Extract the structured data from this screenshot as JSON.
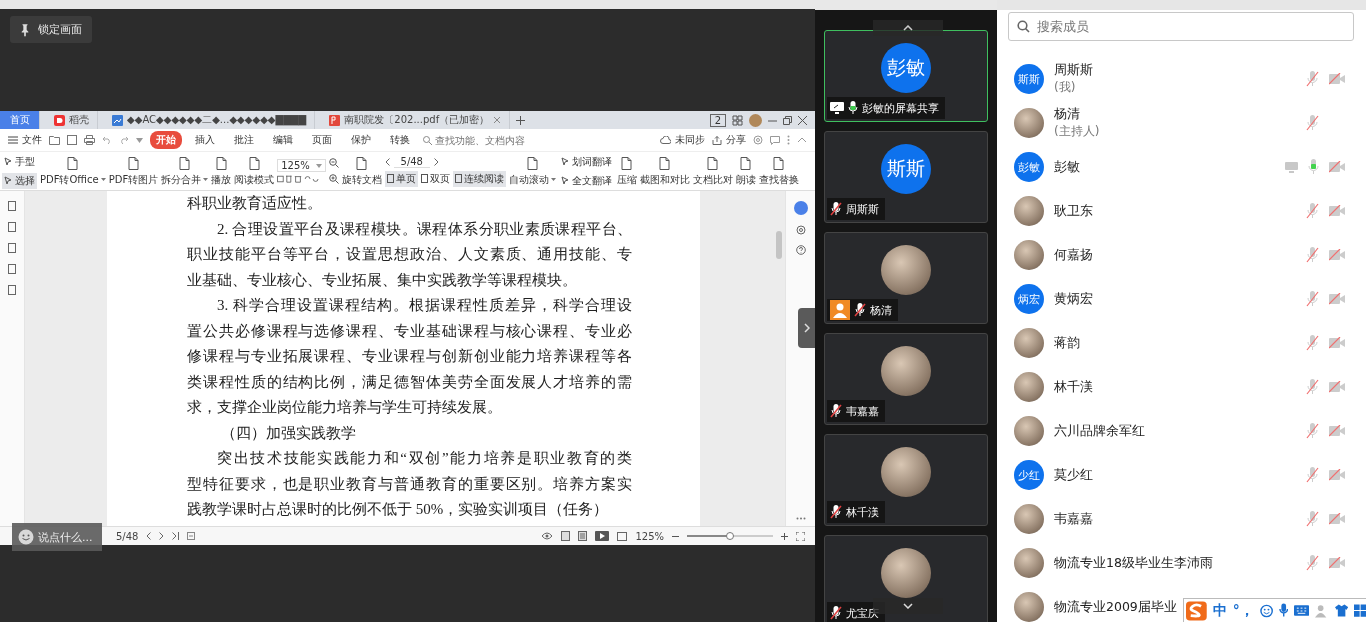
{
  "stage": {
    "lock_button": "锁定画面"
  },
  "wps": {
    "tabs": [
      {
        "label": "首页",
        "selected": true,
        "kind": "home"
      },
      {
        "label": "稻壳",
        "selected": false,
        "kind": "app"
      },
      {
        "label": "◆◆AC◆◆◆◆◆◆二◆...◆◆◆◆◆◆▇▇▇▇",
        "selected": false,
        "kind": "image"
      },
      {
        "label": "南职院发〔202...pdf（已加密）",
        "selected": false,
        "kind": "pdf"
      }
    ],
    "window_badge": "2",
    "menu": {
      "file": "文件",
      "tabs": [
        {
          "label": "开始",
          "selected": true
        },
        {
          "label": "插入",
          "selected": false
        },
        {
          "label": "批注",
          "selected": false
        },
        {
          "label": "编辑",
          "selected": false
        },
        {
          "label": "页面",
          "selected": false
        },
        {
          "label": "保护",
          "selected": false
        },
        {
          "label": "转换",
          "selected": false
        }
      ],
      "search_placeholder": "查找功能、文档内容",
      "sync": "未同步",
      "share": "分享"
    },
    "toolbar": [
      {
        "kind": "stack",
        "items": [
          {
            "label": "手型",
            "selected": false
          },
          {
            "label": "选择",
            "selected": true
          }
        ]
      },
      {
        "kind": "large",
        "label": "PDF转Office",
        "dropdown": true
      },
      {
        "kind": "large",
        "label": "PDF转图片",
        "dropdown": false
      },
      {
        "kind": "large",
        "label": "拆分合并",
        "dropdown": true
      },
      {
        "kind": "large",
        "label": "播放",
        "dropdown": false
      },
      {
        "kind": "large",
        "label": "阅读模式",
        "dropdown": false
      },
      {
        "kind": "zoom",
        "value": "125%"
      },
      {
        "kind": "large",
        "label": "旋转文档",
        "dropdown": false
      },
      {
        "kind": "pager",
        "value": "5/48",
        "items": [
          {
            "label": "单页",
            "selected": true
          },
          {
            "label": "双页",
            "selected": false
          },
          {
            "label": "连续阅读",
            "selected": true
          }
        ]
      },
      {
        "kind": "large",
        "label": "自动滚动",
        "dropdown": true
      },
      {
        "kind": "stack",
        "items": [
          {
            "label": "划词翻译",
            "selected": false
          },
          {
            "label": "全文翻译",
            "selected": false
          }
        ]
      },
      {
        "kind": "large",
        "label": "压缩",
        "dropdown": false
      },
      {
        "kind": "large",
        "label": "截图和对比",
        "dropdown": false
      },
      {
        "kind": "large",
        "label": "文档比对",
        "dropdown": false
      },
      {
        "kind": "large",
        "label": "朗读",
        "dropdown": false
      },
      {
        "kind": "large",
        "label": "查找替换",
        "dropdown": false
      }
    ],
    "document": [
      {
        "kind": "continuation",
        "lines": [
          "科职业教育适应性。"
        ]
      },
      {
        "kind": "paragraph",
        "lines": [
          "2. 合理设置平台及课程模块。课程体系分职业素质课程平台、",
          "职业技能平台等平台，设置思想政治、人文素质、通用技能、专",
          "业基础、专业核心、专业拓展、集中实践教学等课程模块。"
        ]
      },
      {
        "kind": "paragraph",
        "lines": [
          "3. 科学合理设置课程结构。根据课程性质差异，科学合理设",
          "置公共必修课程与选修课程、专业基础课程与核心课程、专业必",
          "修课程与专业拓展课程、专业课程与创新创业能力培养课程等各",
          "类课程性质的结构比例，满足德智体美劳全面发展人才培养的需",
          "求，支撑企业岗位能力培养与学生可持续发展。"
        ]
      },
      {
        "kind": "heading",
        "lines": [
          "（四）加强实践教学"
        ]
      },
      {
        "kind": "paragraph",
        "lines": [
          "突出技术技能实践能力和“双创”能力培养是职业教育的类",
          "型特征要求，也是职业教育与普通教育的重要区别。培养方案实",
          "践教学课时占总课时的比例不低于 50%，实验实训项目（任务）"
        ]
      }
    ],
    "status": {
      "page": "5/48",
      "zoom": "125%",
      "level": 0.5
    }
  },
  "chat": {
    "placeholder": "说点什么..."
  },
  "tiles": [
    {
      "label": "彭敏的屏幕共享",
      "avatar": {
        "kind": "initials",
        "text": "彭敏"
      },
      "muted": false,
      "sharing": true,
      "host": false,
      "selected": true
    },
    {
      "label": "周斯斯",
      "avatar": {
        "kind": "initials",
        "text": "斯斯"
      },
      "muted": true,
      "sharing": false,
      "host": false,
      "selected": false
    },
    {
      "label": "杨清",
      "avatar": {
        "kind": "photo"
      },
      "muted": true,
      "sharing": false,
      "host": true,
      "selected": false
    },
    {
      "label": "韦嘉嘉",
      "avatar": {
        "kind": "photo"
      },
      "muted": true,
      "sharing": false,
      "host": false,
      "selected": false
    },
    {
      "label": "林千渼",
      "avatar": {
        "kind": "photo"
      },
      "muted": true,
      "sharing": false,
      "host": false,
      "selected": false
    },
    {
      "label": "尤宝庆",
      "avatar": {
        "kind": "photo"
      },
      "muted": true,
      "sharing": false,
      "host": false,
      "selected": false
    }
  ],
  "members": {
    "search_placeholder": "搜索成员",
    "list": [
      {
        "name": "周斯斯",
        "note": "(我)",
        "avatar": {
          "kind": "initials",
          "text": "斯斯"
        },
        "muted": true,
        "camera_off": true,
        "sharing": false
      },
      {
        "name": "杨清",
        "note": "(主持人)",
        "avatar": {
          "kind": "photo"
        },
        "muted": true,
        "camera_off": false,
        "sharing": false
      },
      {
        "name": "彭敏",
        "avatar": {
          "kind": "initials",
          "text": "彭敏"
        },
        "muted": false,
        "camera_off": true,
        "sharing": true
      },
      {
        "name": "耿卫东",
        "avatar": {
          "kind": "photo"
        },
        "muted": true,
        "camera_off": true,
        "sharing": false
      },
      {
        "name": "何嘉扬",
        "avatar": {
          "kind": "photo"
        },
        "muted": true,
        "camera_off": true,
        "sharing": false
      },
      {
        "name": "黄炳宏",
        "avatar": {
          "kind": "initials",
          "text": "炳宏"
        },
        "muted": true,
        "camera_off": true,
        "sharing": false
      },
      {
        "name": "蒋韵",
        "avatar": {
          "kind": "photo"
        },
        "muted": true,
        "camera_off": true,
        "sharing": false
      },
      {
        "name": "林千渼",
        "avatar": {
          "kind": "photo"
        },
        "muted": true,
        "camera_off": true,
        "sharing": false
      },
      {
        "name": "六川品牌余军红",
        "avatar": {
          "kind": "photo"
        },
        "muted": true,
        "camera_off": true,
        "sharing": false
      },
      {
        "name": "莫少红",
        "avatar": {
          "kind": "initials",
          "text": "少红"
        },
        "muted": true,
        "camera_off": true,
        "sharing": false
      },
      {
        "name": "韦嘉嘉",
        "avatar": {
          "kind": "photo"
        },
        "muted": true,
        "camera_off": true,
        "sharing": false
      },
      {
        "name": "物流专业18级毕业生李沛雨",
        "avatar": {
          "kind": "photo"
        },
        "muted": true,
        "camera_off": true,
        "sharing": false
      },
      {
        "name": "物流专业2009届毕业",
        "avatar": {
          "kind": "photo"
        }
      }
    ]
  },
  "ime": {
    "mode": "中",
    "punct": "°，"
  }
}
